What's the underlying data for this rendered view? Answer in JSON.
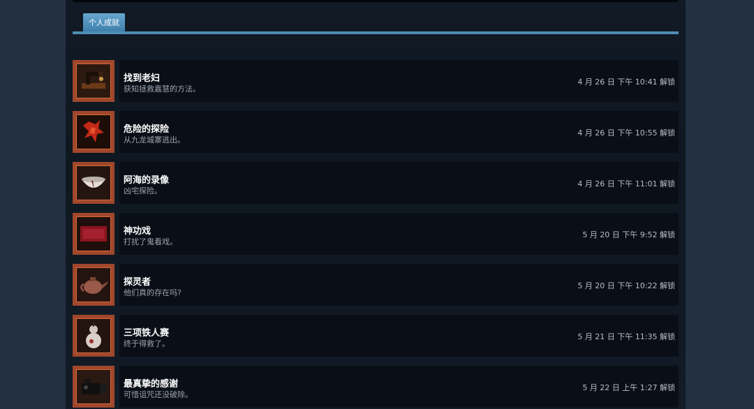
{
  "tabs": [
    {
      "label": "个人成就",
      "active": true
    }
  ],
  "colors": {
    "tab_active": "#4f8db5",
    "thumbnail_frame": "#a0472c",
    "card_background": "#0a0f17"
  },
  "achievements": [
    {
      "title": "找到老妇",
      "description": "获知拯救嘉慧的方法。",
      "unlocked": "4 月 26 日 下午 10:41 解锁",
      "icon": "sewing-machine-icon"
    },
    {
      "title": "危险的探险",
      "description": "从九龙城寨逃出。",
      "unlocked": "4 月 26 日 下午 10:55 解锁",
      "icon": "red-creature-icon"
    },
    {
      "title": "阿海的录像",
      "description": "凶宅探险。",
      "unlocked": "4 月 26 日 下午 11:01 解锁",
      "icon": "bowl-icon"
    },
    {
      "title": "神功戏",
      "description": "打扰了鬼看戏。",
      "unlocked": "5 月 20 日 下午 9:52 解锁",
      "icon": "red-cloth-icon"
    },
    {
      "title": "探灵者",
      "description": "他们真的存在吗?",
      "unlocked": "5 月 20 日 下午 10:22 解锁",
      "icon": "teapot-icon"
    },
    {
      "title": "三项铁人赛",
      "description": "终于得救了。",
      "unlocked": "5 月 21 日 下午 11:35 解锁",
      "icon": "gourd-icon"
    },
    {
      "title": "最真挚的感谢",
      "description": "可惜诅咒还没破除。",
      "unlocked": "5 月 22 日 上午 1:27 解锁",
      "icon": "camera-icon"
    }
  ]
}
